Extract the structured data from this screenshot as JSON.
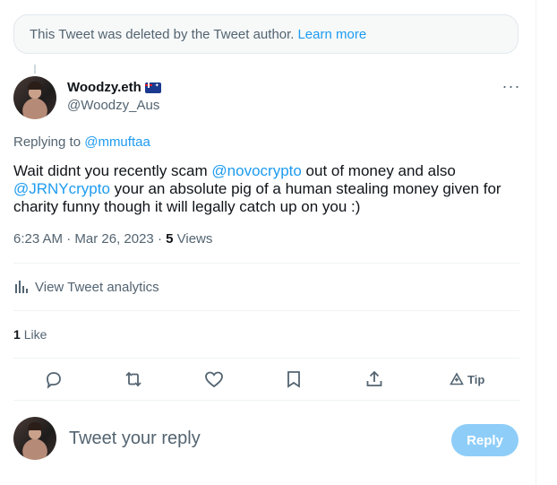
{
  "deleted_notice": {
    "text": "This Tweet was deleted by the Tweet author.",
    "link": "Learn more"
  },
  "author": {
    "display_name": "Woodzy.eth",
    "handle": "@Woodzy_Aus",
    "flag_icon": "australia-flag-icon"
  },
  "replying": {
    "prefix": "Replying to",
    "mention": "@mmuftaa"
  },
  "tweet": {
    "part1": "Wait didnt you recently scam ",
    "mention1": "@novocrypto",
    "part2": " out of money and also ",
    "mention2": "@JRNYcrypto",
    "part3": " your an absolute pig of a human stealing money given for charity funny though it will legally catch up on you :)"
  },
  "meta": {
    "time": "6:23 AM",
    "separator": "·",
    "date": "Mar 26, 2023",
    "views_count": "5",
    "views_label": "Views"
  },
  "analytics": {
    "label": "View Tweet analytics"
  },
  "likes": {
    "count": "1",
    "label": "Like"
  },
  "actions": {
    "tip_label": "Tip"
  },
  "reply_box": {
    "placeholder": "Tweet your reply",
    "button_label": "Reply"
  },
  "colors": {
    "accent": "#1d9bf0",
    "reply_button_disabled": "#8ecdf8",
    "muted_text": "#536471"
  }
}
